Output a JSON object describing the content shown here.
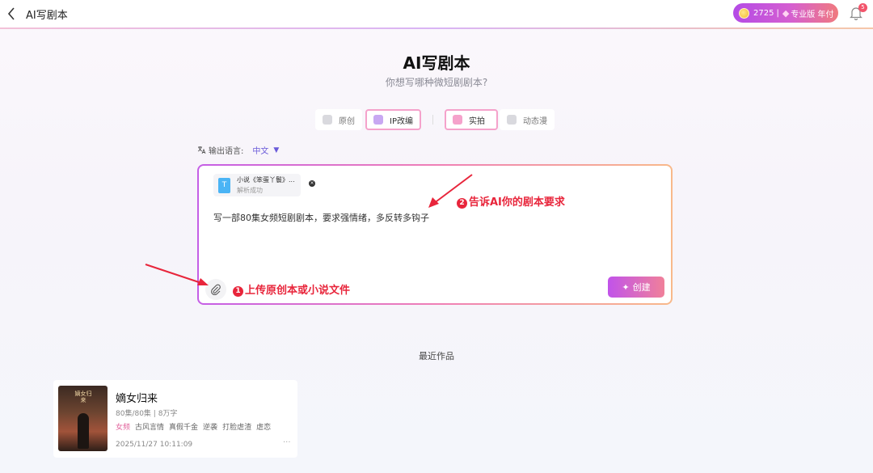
{
  "header": {
    "title": "AI写剧本",
    "credits": "2725",
    "separator": "|",
    "plan": "专业版 年付",
    "notification_count": "5"
  },
  "hero": {
    "title": "AI写剧本",
    "subtitle": "你想写哪种微短剧剧本?"
  },
  "modes": {
    "group1": [
      {
        "label": "原创",
        "active": false
      },
      {
        "label": "IP改编",
        "active": true
      }
    ],
    "group2": [
      {
        "label": "实拍",
        "active": true
      },
      {
        "label": "动态漫",
        "active": false
      }
    ]
  },
  "language": {
    "label": "输出语言:",
    "value": "中文"
  },
  "editor": {
    "file": {
      "name": "小说《笨蛋丫鬟》...",
      "status": "解析成功",
      "icon_letter": "T"
    },
    "prompt": "写一部80集女频短剧剧本，要求强情绪，多反转多钩子",
    "create_label": "创建"
  },
  "annotations": {
    "a1_num": "1",
    "a1_text": "上传原创本或小说文件",
    "a2_num": "2",
    "a2_text": "告诉AI你的剧本要求",
    "color": "#e8253b"
  },
  "recent": {
    "title": "最近作品",
    "items": [
      {
        "title": "嫡女归来",
        "cover_text": "嫡女归来",
        "meta": "80集/80集 | 8万字",
        "tags": [
          "女频",
          "古风言情",
          "真假千金",
          "逆袭",
          "打脸虐渣",
          "虐恋"
        ],
        "date": "2025/11/27 10:11:09",
        "more": "···"
      }
    ]
  },
  "colors": {
    "accent": "#6a5ad9",
    "pink": "#e2649d",
    "gradient_start": "#c153ea",
    "gradient_end": "#f0809a"
  }
}
